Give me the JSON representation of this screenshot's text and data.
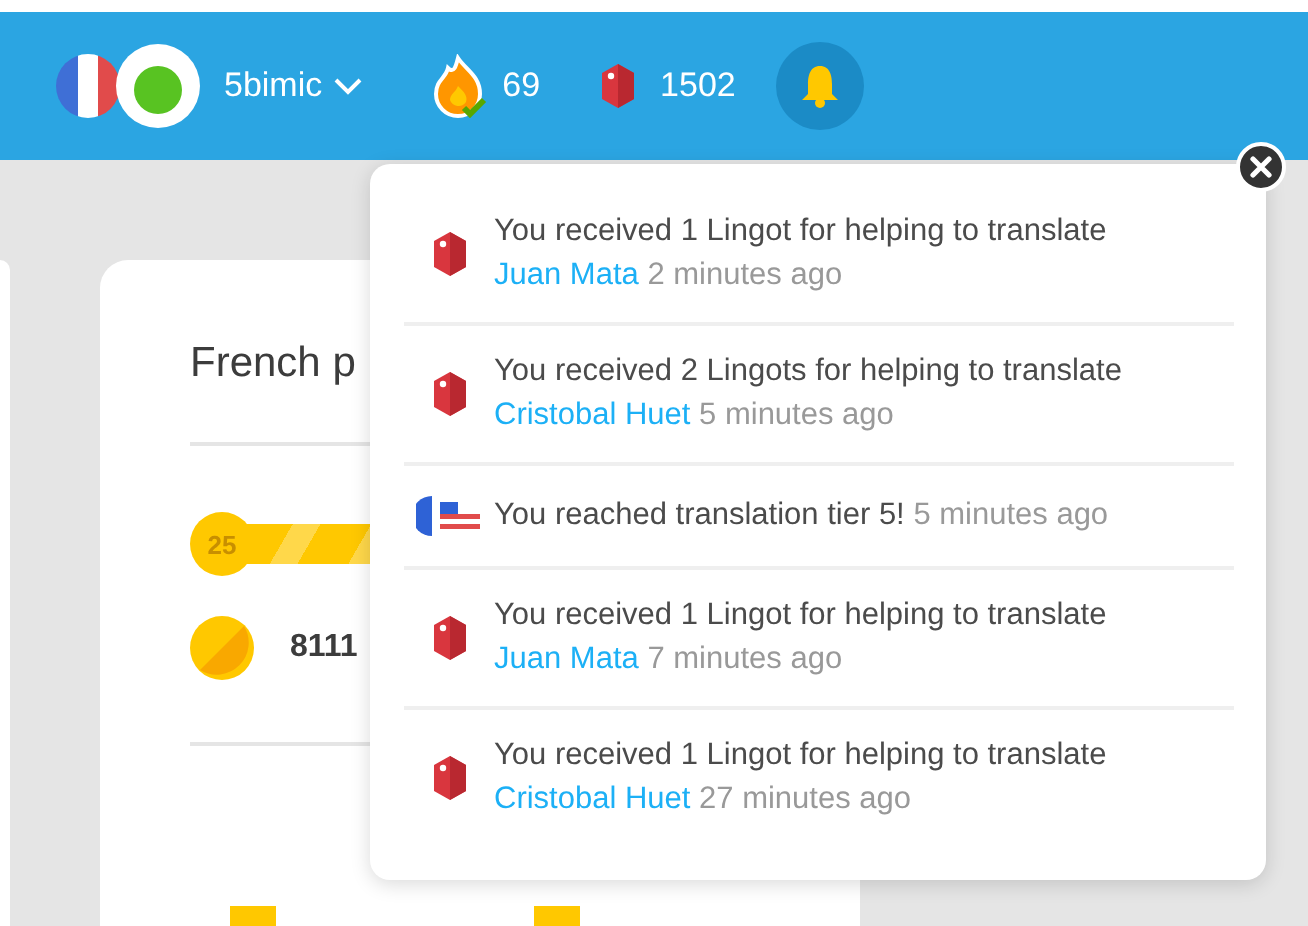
{
  "header": {
    "username": "5bimic",
    "streak": "69",
    "lingots": "1502"
  },
  "course_card": {
    "title": "French p",
    "level": "25",
    "xp": "8111"
  },
  "notifications": [
    {
      "kind": "lingot",
      "message": "You received 1 Lingot for helping to translate",
      "user": "Juan Mata",
      "time": "2 minutes ago"
    },
    {
      "kind": "lingot",
      "message": "You received 2 Lingots for helping to translate",
      "user": "Cristobal Huet",
      "time": "5 minutes ago"
    },
    {
      "kind": "tier",
      "message": "You reached translation tier 5!",
      "time": "5 minutes ago"
    },
    {
      "kind": "lingot",
      "message": "You received 1 Lingot for helping to translate",
      "user": "Juan Mata",
      "time": "7 minutes ago"
    },
    {
      "kind": "lingot",
      "message": "You received 1 Lingot for helping to translate",
      "user": "Cristobal Huet",
      "time": "27 minutes ago"
    }
  ]
}
